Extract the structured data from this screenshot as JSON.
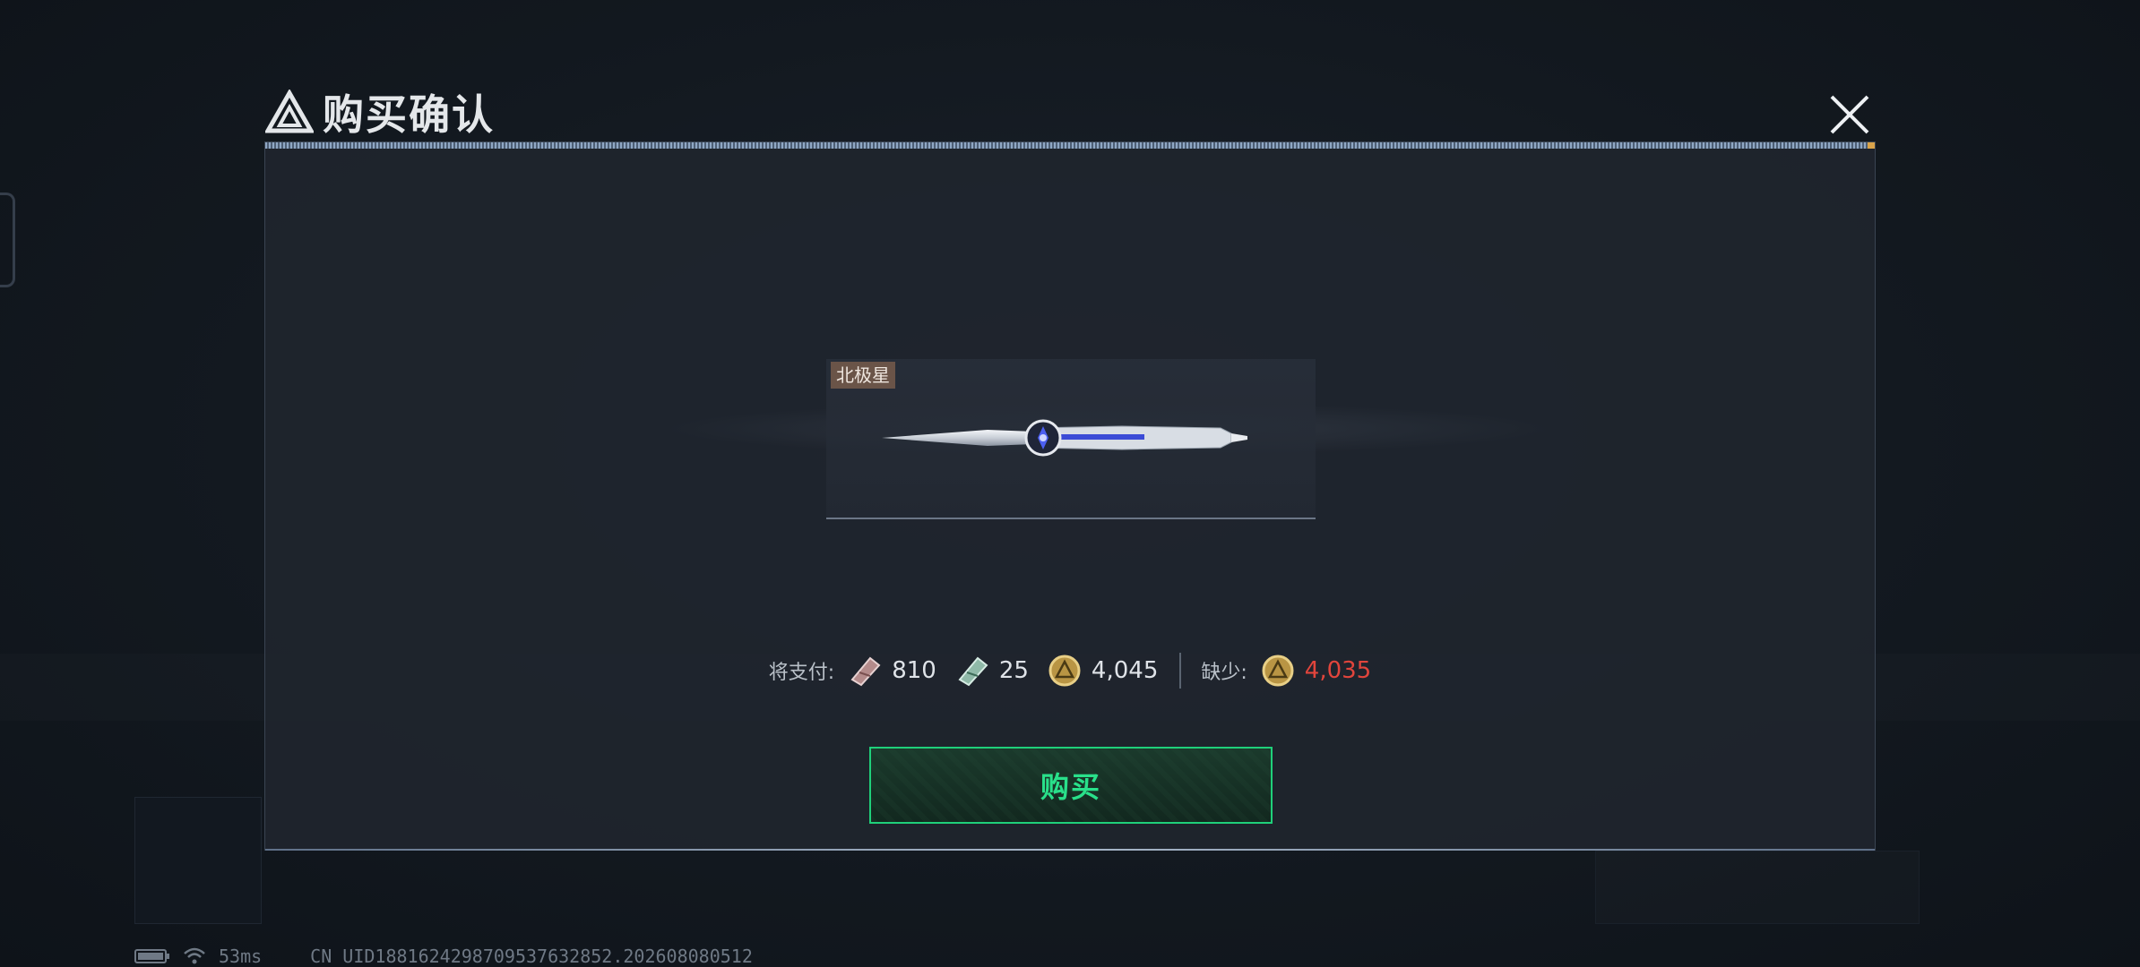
{
  "dialog": {
    "title": "购买确认",
    "close_icon": "close-icon"
  },
  "item": {
    "name_tag": "北极星",
    "image": "knife-weapon-icon"
  },
  "payment": {
    "label": "将支付:",
    "costs": [
      {
        "icon": "ticket-red-icon",
        "value": "810"
      },
      {
        "icon": "ticket-green-icon",
        "value": "25"
      },
      {
        "icon": "gold-coin-icon",
        "value": "4,045"
      }
    ],
    "shortage_label": "缺少:",
    "shortage": {
      "icon": "gold-coin-icon",
      "value": "4,035",
      "color": "#e1453c"
    }
  },
  "buy_button": {
    "label": "购买",
    "accent": "#1fd07a"
  },
  "status_bar": {
    "ping": "53ms",
    "uid": "CN UID1881624298709537632852.202608080512"
  }
}
